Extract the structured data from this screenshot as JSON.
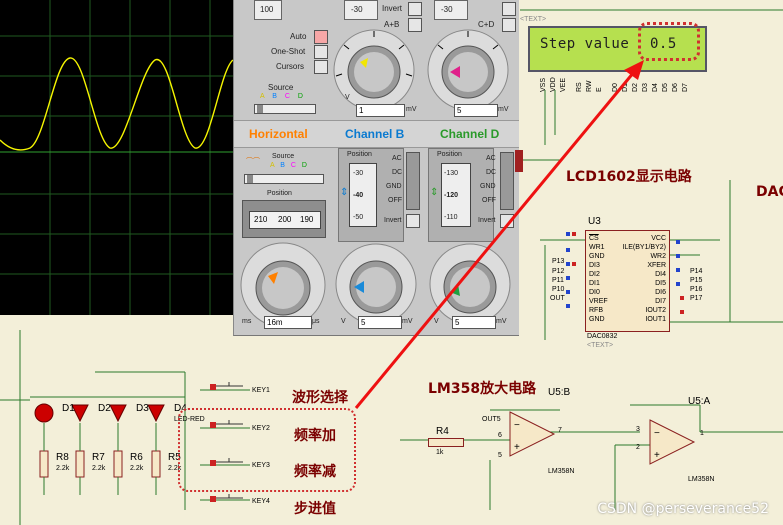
{
  "scope": {
    "horizontal_title": "Horizontal",
    "channel_b_title": "Channel B",
    "channel_d_title": "Channel D",
    "top_knob_value": "100",
    "top_knob2_value": "-30",
    "top_knob3_value": "-30",
    "invert_label": "Invert",
    "a_plus_b_label": "A+B",
    "c_plus_d_label": "C+D",
    "auto_label": "Auto",
    "oneshot_label": "One-Shot",
    "cursors_label": "Cursors",
    "source_label": "Source",
    "source_letters": [
      "A",
      "B",
      "C",
      "D"
    ],
    "position_label": "Position",
    "pos_scale": [
      "210",
      "200",
      "190"
    ],
    "ac_label": "AC",
    "dc_label": "DC",
    "gnd_label": "GND",
    "off_label": "OFF",
    "chb_pos_scale": [
      "-30",
      "-40",
      "-50"
    ],
    "chd_pos_scale": [
      "-130",
      "-120",
      "-110"
    ],
    "units_v": "V",
    "units_mv": "mV",
    "units_ms": "ms",
    "units_us": "μs",
    "top_field_b": "1",
    "top_field_d": "5",
    "time_field": "16m",
    "bot_field_b": "5",
    "bot_field_d": "5",
    "knob_scale_top": "20",
    "knob_scale_labels": [
      "50",
      "20",
      "10",
      "5",
      "2",
      "1",
      "0.5",
      "0.2",
      "0.1"
    ],
    "colors": {
      "ch_a": "#ffff00",
      "ch_b": "#0080ff",
      "ch_c": "#ff00ff",
      "ch_d": "#00a000",
      "horizontal": "#ff8000"
    }
  },
  "lcd": {
    "text": "Step value",
    "value": "0.5",
    "label": "LCD1602显示电路",
    "pins": [
      "VSS",
      "VDD",
      "VEE",
      "RS",
      "RW",
      "E",
      "D0",
      "D1",
      "D2",
      "D3",
      "D4",
      "D5",
      "D6",
      "D7"
    ]
  },
  "dac": {
    "ref": "U3",
    "name": "DAC0832",
    "text_tag": "<TEXT>",
    "left_pins": [
      "CS",
      "WR1",
      "GND",
      "DI3",
      "DI2",
      "DI1",
      "DI0",
      "VREF",
      "RFB",
      "GND"
    ],
    "right_pins": [
      "VCC",
      "ILE(BY1/BY2)",
      "WR2",
      "XFER",
      "DI4",
      "DI5",
      "DI6",
      "DI7",
      "IOUT2",
      "IOUT1"
    ],
    "left_nums": [
      "1",
      "2",
      "3",
      "4",
      "5",
      "6",
      "7",
      "8",
      "9",
      "10"
    ],
    "right_nums": [
      "20",
      "19",
      "18",
      "17",
      "16",
      "15",
      "14",
      "13",
      "12",
      "11"
    ],
    "port_left": [
      "P13",
      "P12",
      "P11",
      "P10",
      "OUT"
    ],
    "port_right": [
      "P14",
      "P15",
      "P16",
      "P17"
    ],
    "dac_label_partial": "DAC"
  },
  "amp": {
    "title": "LM358放大电路",
    "u5b": "U5:B",
    "u5a": "U5:A",
    "part": "LM358N",
    "r4": "R4",
    "r4_val": "1k",
    "out5": "OUT5",
    "pin3": "3",
    "pin2": "2",
    "pin5": "5",
    "pin6": "6",
    "pin7": "7",
    "pin1": "1"
  },
  "keys": {
    "k1": "KEY1",
    "k2": "KEY2",
    "k3": "KEY3",
    "k4": "KEY4",
    "label_wave": "波形选择",
    "label_up": "频率加",
    "label_down": "频率减",
    "label_step": "步进值"
  },
  "leds": {
    "d1": "D1",
    "d2": "D2",
    "d3": "D3",
    "d4": "D4",
    "led_type": "LED-RED",
    "resistors": [
      "R8",
      "R7",
      "R6",
      "R5"
    ],
    "res_val": "2.2k"
  },
  "watermark": "CSDN @perseverance52"
}
